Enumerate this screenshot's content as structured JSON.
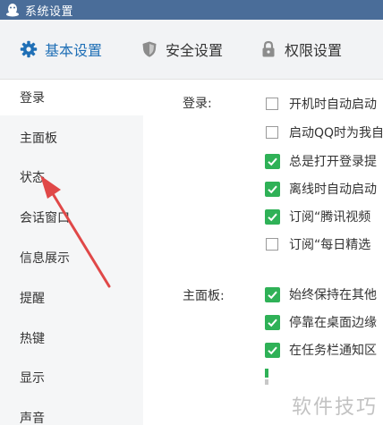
{
  "window": {
    "title": "系统设置"
  },
  "tabs": [
    {
      "label": "基本设置",
      "icon": "gear-icon",
      "active": true
    },
    {
      "label": "安全设置",
      "icon": "shield-icon",
      "active": false
    },
    {
      "label": "权限设置",
      "icon": "lock-icon",
      "active": false
    }
  ],
  "sidebar": {
    "items": [
      {
        "label": "登录",
        "active": true
      },
      {
        "label": "主面板"
      },
      {
        "label": "状态"
      },
      {
        "label": "会话窗口"
      },
      {
        "label": "信息展示"
      },
      {
        "label": "提醒"
      },
      {
        "label": "热键"
      },
      {
        "label": "显示"
      },
      {
        "label": "声音"
      }
    ]
  },
  "content": {
    "login": {
      "label": "登录:",
      "options": [
        {
          "text": "开机时自动启动",
          "checked": false
        },
        {
          "text": "启动QQ时为我自",
          "checked": false
        },
        {
          "text": "总是打开登录提",
          "checked": true
        },
        {
          "text": "离线时自动启动",
          "checked": true
        },
        {
          "text": "订阅“腾讯视频",
          "checked": true
        },
        {
          "text": "订阅“每日精选",
          "checked": false
        }
      ]
    },
    "main_panel": {
      "label": "主面板:",
      "options": [
        {
          "text": "始终保持在其他",
          "checked": true
        },
        {
          "text": "停靠在桌面边缘",
          "checked": true
        },
        {
          "text": "在任务栏通知区",
          "checked": true
        }
      ]
    }
  },
  "watermark": "软件技巧",
  "colors": {
    "titlebar": "#4a6d99",
    "accent": "#1f6fb6",
    "checkbox_checked": "#2fb157",
    "arrow": "#e04848"
  }
}
